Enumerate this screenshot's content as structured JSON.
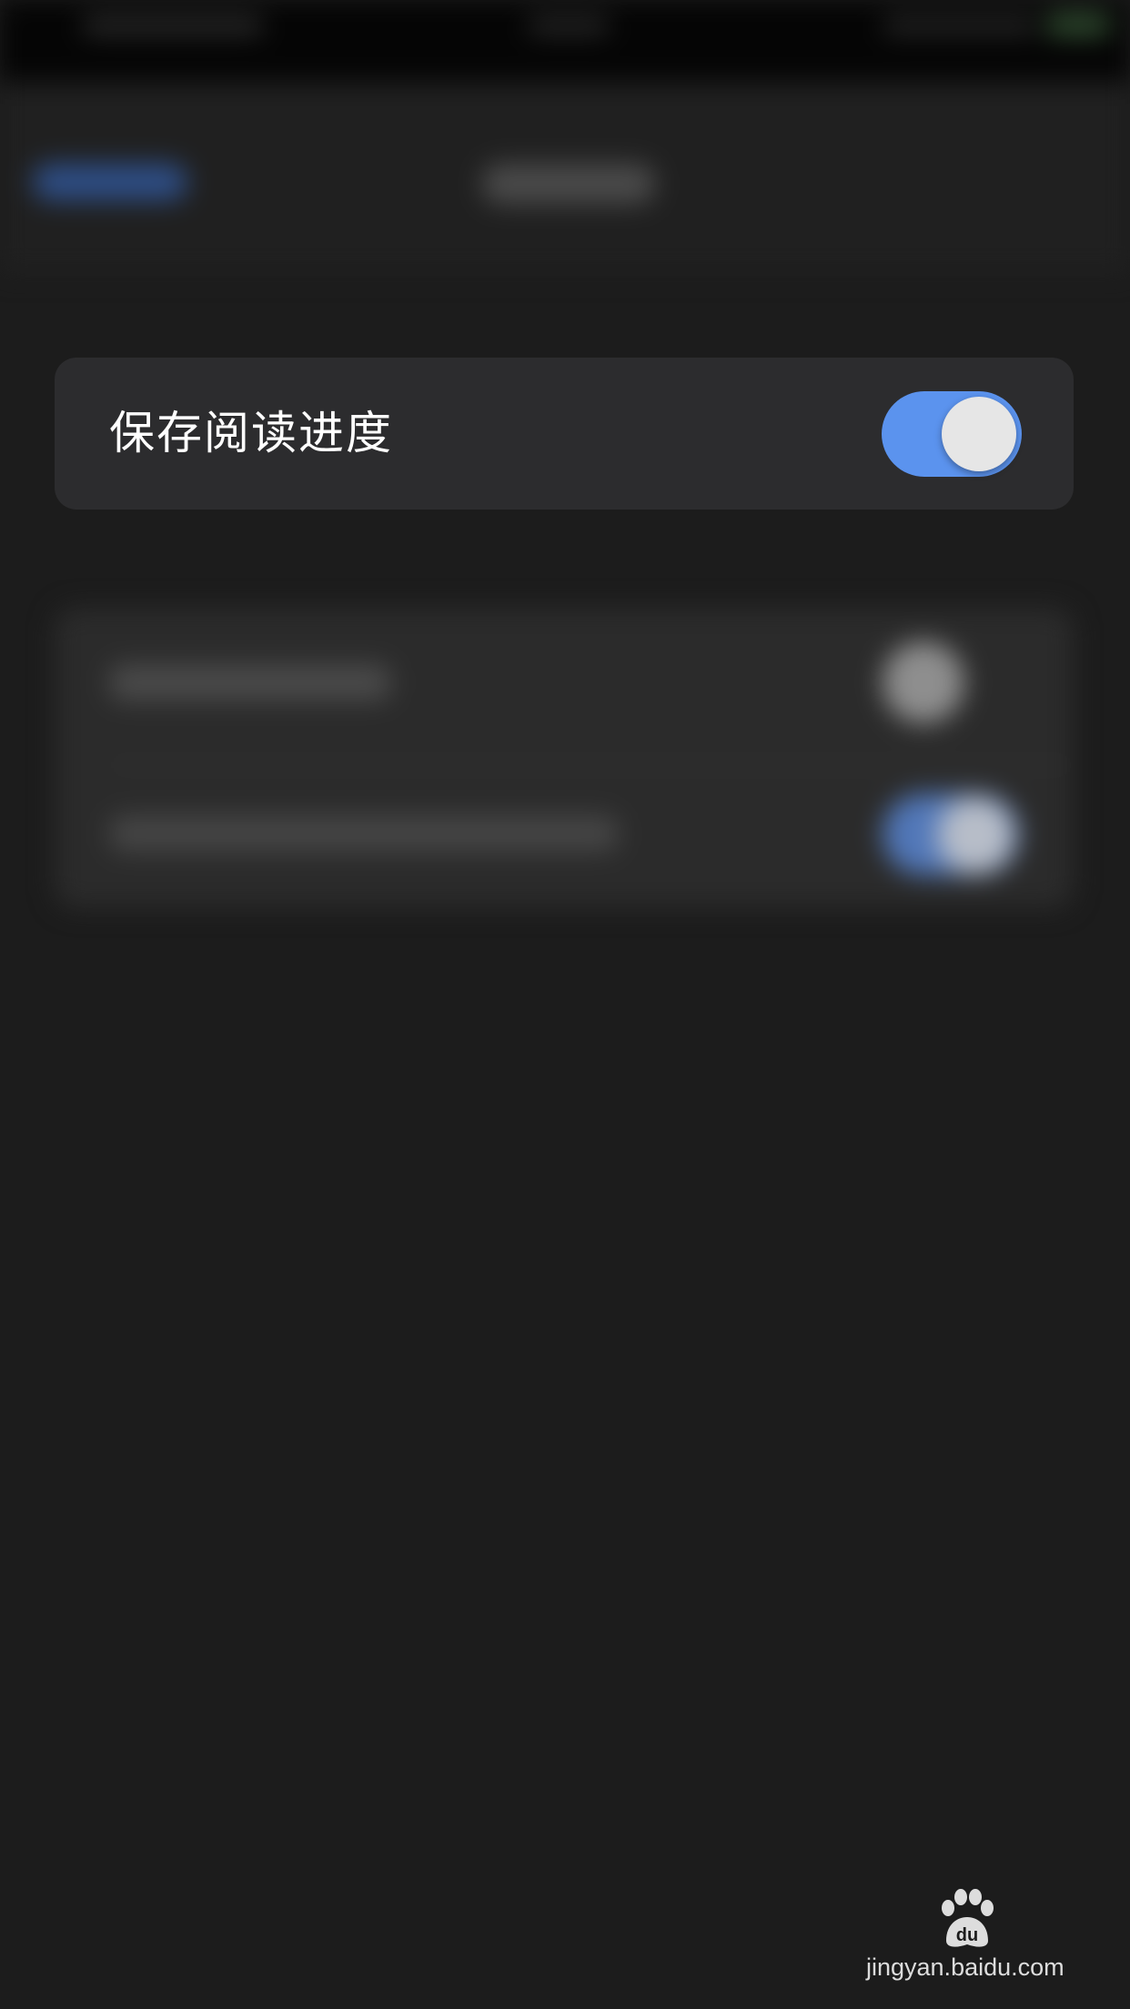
{
  "setting": {
    "label": "保存阅读进度",
    "toggle_on": true
  },
  "colors": {
    "background": "#1c1c1c",
    "card": "#2c2c2e",
    "toggle_on": "#5b93ee",
    "knob": "#e6e6e6"
  },
  "watermark": {
    "logo": "Bai经验",
    "url": "jingyan.baidu.com"
  }
}
